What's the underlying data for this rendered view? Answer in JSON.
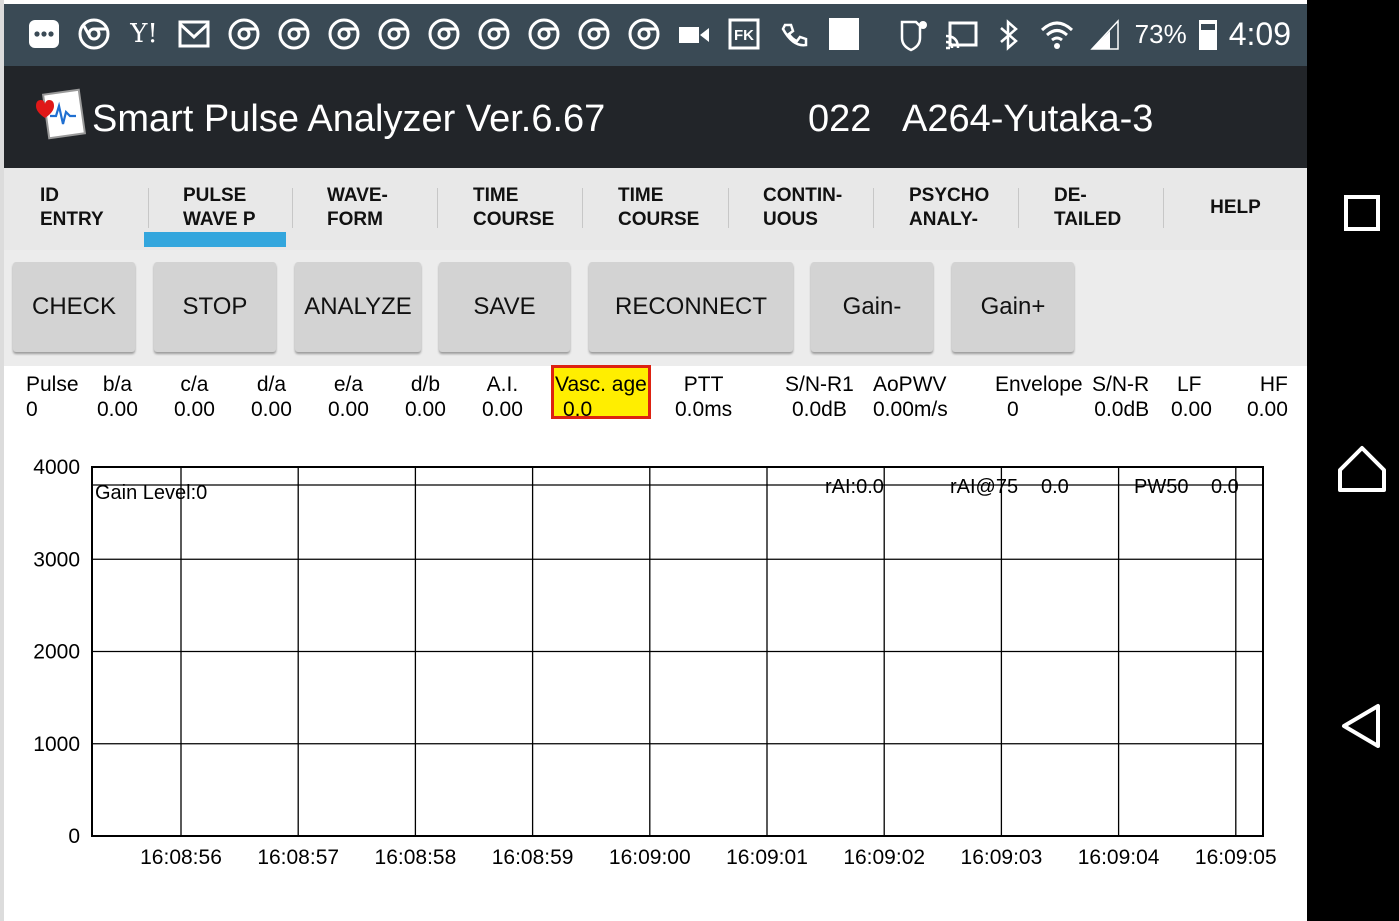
{
  "status_bar": {
    "left_icons": [
      "more-icon",
      "chrome-icon",
      "yahoo-icon",
      "gmail-icon",
      "chrome-icon",
      "chrome-icon",
      "chrome-icon",
      "chrome-icon",
      "chrome-icon",
      "chrome-icon",
      "chrome-icon",
      "chrome-icon",
      "chrome-icon",
      "video-icon",
      "fk-icon",
      "wifi-call-icon",
      "blank-icon"
    ],
    "yahoo_text": "Y!",
    "fk_text": "FK",
    "battery_percent": "73%",
    "time": "4:09",
    "battery_level": 0.73
  },
  "title_bar": {
    "title": "Smart Pulse Analyzer Ver.6.67",
    "code": "022",
    "user": "A264-Yutaka-3"
  },
  "tabs": [
    {
      "label": "ID\nENTRY",
      "active": false
    },
    {
      "label": "PULSE\nWAVE P",
      "active": true
    },
    {
      "label": "WAVE-\nFORM",
      "active": false
    },
    {
      "label": "TIME\nCOURSE",
      "active": false
    },
    {
      "label": "TIME\nCOURSE",
      "active": false
    },
    {
      "label": "CONTIN-\nUOUS",
      "active": false
    },
    {
      "label": "PSYCHO\nANALY-",
      "active": false
    },
    {
      "label": "DE-\nTAILED",
      "active": false
    },
    {
      "label": "HELP",
      "active": false
    }
  ],
  "buttons": {
    "check": "CHECK",
    "stop": "STOP",
    "analyze": "ANALYZE",
    "save": "SAVE",
    "reconnect": "RECONNECT",
    "gain_minus": "Gain-",
    "gain_plus": "Gain+"
  },
  "metrics": [
    {
      "label": "Pulse",
      "value": "0"
    },
    {
      "label": "b/a",
      "value": "0.00"
    },
    {
      "label": "c/a",
      "value": "0.00"
    },
    {
      "label": "d/a",
      "value": "0.00"
    },
    {
      "label": "e/a",
      "value": "0.00"
    },
    {
      "label": "d/b",
      "value": "0.00"
    },
    {
      "label": "A.I.",
      "value": "0.00"
    },
    {
      "label": "Vasc. age",
      "value": "0.0"
    },
    {
      "label": "PTT",
      "value": "0.0ms"
    },
    {
      "label": "S/N-R1",
      "value": "0.0dB"
    },
    {
      "label": "AoPWV",
      "value": "0.00m/s"
    },
    {
      "label": "Envelope",
      "value": "0"
    },
    {
      "label": "S/N-R",
      "value": "0.0dB"
    },
    {
      "label": "LF",
      "value": "0.00"
    },
    {
      "label": "HF",
      "value": "0.00"
    }
  ],
  "chart_data": {
    "type": "line",
    "title": "",
    "xlabel": "",
    "ylabel": "",
    "ylim": [
      0,
      4000
    ],
    "y_ticks": [
      "0",
      "1000",
      "2000",
      "3000",
      "4000"
    ],
    "x_ticks": [
      "16:08:56",
      "16:08:57",
      "16:08:58",
      "16:08:59",
      "16:09:00",
      "16:09:01",
      "16:09:02",
      "16:09:03",
      "16:09:04",
      "16:09:05"
    ],
    "grid": true,
    "series": [],
    "annotations": {
      "gain_level": "Gain Level:0",
      "rai": "rAI:0.0",
      "rai75_label": "rAI@75",
      "rai75_value": "0.0",
      "pw50_label": "PW50",
      "pw50_value": "0.0"
    }
  },
  "nav_bar": {
    "icons": [
      "recents-icon",
      "home-icon",
      "back-icon"
    ]
  }
}
